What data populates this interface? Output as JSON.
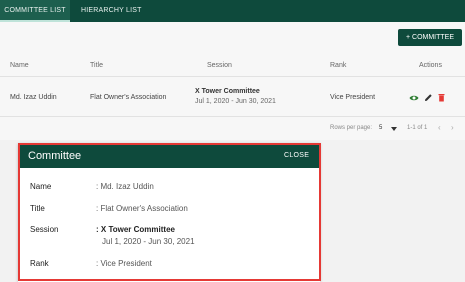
{
  "tabs": [
    {
      "label": "COMMITTEE LIST"
    },
    {
      "label": "HIERARCHY LIST"
    }
  ],
  "add_button": {
    "label": "+ COMMITTEE"
  },
  "table": {
    "headers": [
      "Name",
      "Title",
      "Session",
      "Rank",
      "Actions"
    ],
    "row": {
      "name": "Md. Izaz Uddin",
      "title": "Flat Owner's Association",
      "session_title": "X Tower Committee",
      "session_dates": "Jul 1, 2020 - Jun 30, 2021",
      "rank": "Vice President"
    }
  },
  "pagination": {
    "rows_per_page_label": "Rows per page:",
    "rows_per_page_value": "5",
    "range": "1-1 of 1"
  },
  "modal": {
    "title": "Committee",
    "close_label": "CLOSE",
    "fields": [
      {
        "label": "Name",
        "value": ": Md. Izaz Uddin"
      },
      {
        "label": "Title",
        "value": ": Flat Owner's Association"
      },
      {
        "label": "Session",
        "value": ": X Tower Committee",
        "value2": "Jul 1, 2020 - Jun 30, 2021"
      },
      {
        "label": "Rank",
        "value": ": Vice President"
      }
    ]
  },
  "colors": {
    "brand": "#0e4a3c",
    "edit_icon": "#2e7d32",
    "delete_icon": "#e53935",
    "highlight_border": "#e53935"
  },
  "icons": [
    "eye-icon",
    "pencil-icon",
    "trash-icon",
    "caret-down-icon",
    "chevron-left-icon",
    "chevron-right-icon"
  ]
}
